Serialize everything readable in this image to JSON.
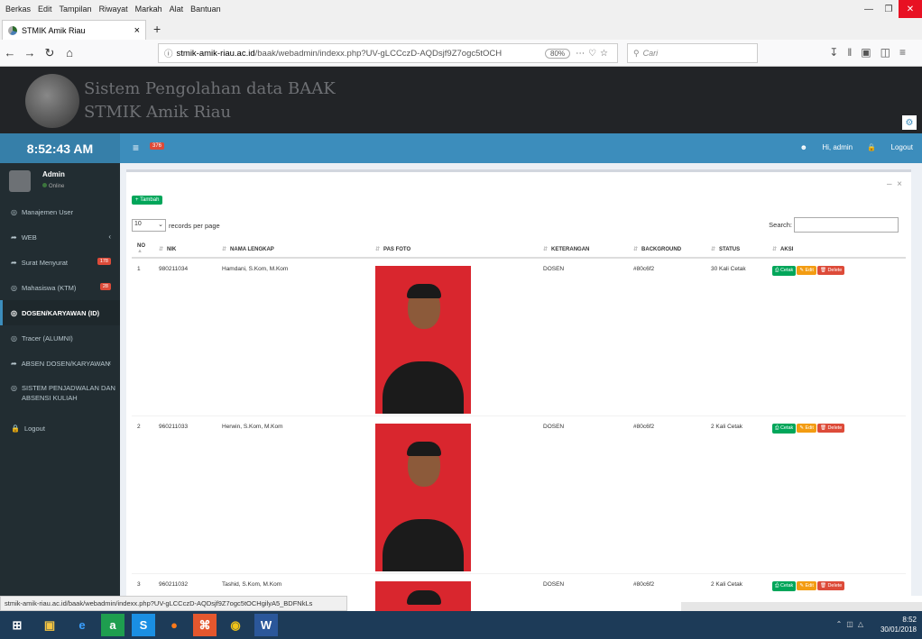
{
  "browser": {
    "menu": [
      "Berkas",
      "Edit",
      "Tampilan",
      "Riwayat",
      "Markah",
      "Alat",
      "Bantuan"
    ],
    "tab_title": "STMIK Amik Riau",
    "url_prefix": "stmik-amik-riau.ac.id",
    "url_rest": "/baak/webadmin/indexx.php?UV-gLCCczD-AQDsjf9Z7ogc5tOCH",
    "zoom": "80%",
    "search_placeholder": "Cari",
    "status_url": "stmik-amik-riau.ac.id/baak/webadmin/indexx.php?UV-gLCCczD-AQDsjf9Z7ogc5tOCHgilyA5_BDFNkLs"
  },
  "banner": {
    "line1": "Sistem Pengolahan data BAAK",
    "line2": "STMIK Amik Riau"
  },
  "header": {
    "clock": "8:52:43 AM",
    "badge": "376",
    "user": "Hi, admin",
    "logout": "Logout"
  },
  "sidebar": {
    "name": "Admin",
    "status": "Online",
    "items": [
      {
        "label": "Manajemen User",
        "icon": "circle-icon"
      },
      {
        "label": "WEB",
        "icon": "share-icon"
      },
      {
        "label": "Surat Menyurat",
        "icon": "share-icon",
        "badge": "178"
      },
      {
        "label": "Mahasiswa (KTM)",
        "icon": "circle-icon",
        "badge": "28"
      },
      {
        "label": "DOSEN/KARYAWAN (ID)",
        "icon": "circle-icon"
      },
      {
        "label": "Tracer (ALUMNI)",
        "icon": "circle-icon"
      },
      {
        "label": "ABSEN DOSEN/KARYAWAN",
        "icon": "share-icon"
      },
      {
        "label": "SISTEM PENJADWALAN DAN ABSENSI KULIAH",
        "icon": "circle-icon"
      },
      {
        "label": "Logout",
        "icon": "lock-icon"
      }
    ]
  },
  "table": {
    "add_label": "+ Tambah",
    "length_value": "10",
    "length_suffix": "records per page",
    "search_label": "Search:",
    "columns": [
      "NO",
      "NIK",
      "NAMA LENGKAP",
      "PAS FOTO",
      "KETERANGAN",
      "BACKGROUND",
      "STATUS",
      "AKSI"
    ],
    "actions": {
      "print": "Cetak",
      "edit": "Edit",
      "delete": "Delete"
    },
    "rows": [
      {
        "no": "1",
        "nik": "980211034",
        "nama": "Hamdani, S.Kom, M.Kom",
        "ket": "DOSEN",
        "bg": "#80c6f2",
        "status": "30 Kali Cetak"
      },
      {
        "no": "2",
        "nik": "960211033",
        "nama": "Herwin, S.Kom, M.Kom",
        "ket": "DOSEN",
        "bg": "#80c6f2",
        "status": "2 Kali Cetak"
      },
      {
        "no": "3",
        "nik": "960211032",
        "nama": "Tashid, S.Kom, M.Kom",
        "ket": "DOSEN",
        "bg": "#80c6f2",
        "status": "2 Kali Cetak"
      }
    ]
  },
  "taskbar": {
    "time": "8:52",
    "date": "30/01/2018"
  },
  "colors": {
    "primary": "#3c8dbc",
    "sidebar": "#222d32",
    "success": "#00a65a",
    "warning": "#f39c12",
    "danger": "#dd4b39"
  }
}
